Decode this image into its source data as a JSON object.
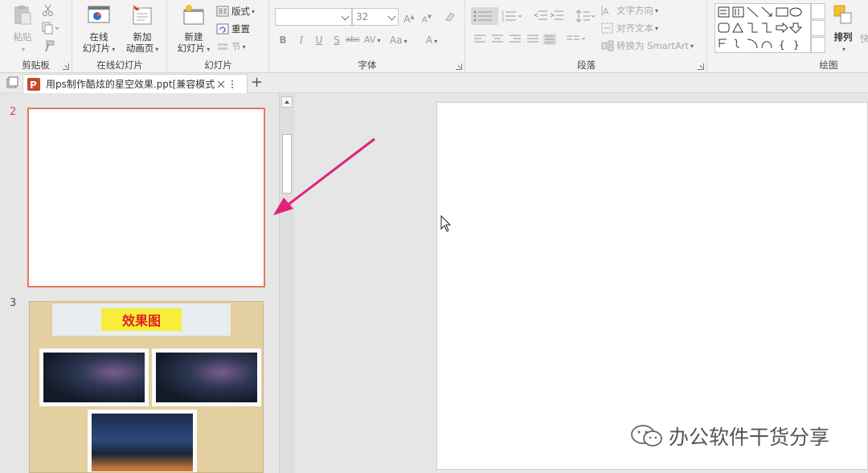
{
  "ribbon": {
    "clipboard": {
      "paste_label": "粘贴",
      "group_label": "剪贴板"
    },
    "online_slides": {
      "online_label_1": "在线",
      "online_label_2": "幻灯片",
      "animation_label_1": "新加",
      "animation_label_2": "动画页",
      "group_label": "在线幻灯片"
    },
    "slides": {
      "new_label_1": "新建",
      "new_label_2": "幻灯片",
      "layout_label": "版式",
      "reset_label": "重置",
      "section_label": "节",
      "group_label": "幻灯片"
    },
    "font": {
      "font_name": "",
      "font_size": "32",
      "bold": "B",
      "italic": "I",
      "underline": "U",
      "shadow": "S",
      "strike": "abc",
      "spacing": "AV",
      "case": "Aa",
      "color": "A",
      "grow": "A",
      "shrink": "A",
      "group_label": "字体"
    },
    "paragraph": {
      "text_direction_label": "文字方向",
      "align_text_label": "对齐文本",
      "smartart_label": "转换为 SmartArt",
      "group_label": "段落"
    },
    "drawing": {
      "arrange_label": "排列",
      "more_label": "快",
      "group_label": "绘图",
      "brace_open": "{",
      "brace_close": "}"
    }
  },
  "tabs": {
    "doc_title": "用ps制作酷炫的星空效果.ppt[兼容模式",
    "new_tab": "+"
  },
  "slides_panel": {
    "slide2_number": "2",
    "slide3_number": "3",
    "slide3_banner": "效果图"
  },
  "watermark": {
    "text": "办公软件干货分享"
  },
  "colors": {
    "accent_orange": "#e8775a",
    "arrow_pink": "#e0217e",
    "banner_yellow": "#f6ee3a",
    "banner_text_red": "#e02020"
  }
}
